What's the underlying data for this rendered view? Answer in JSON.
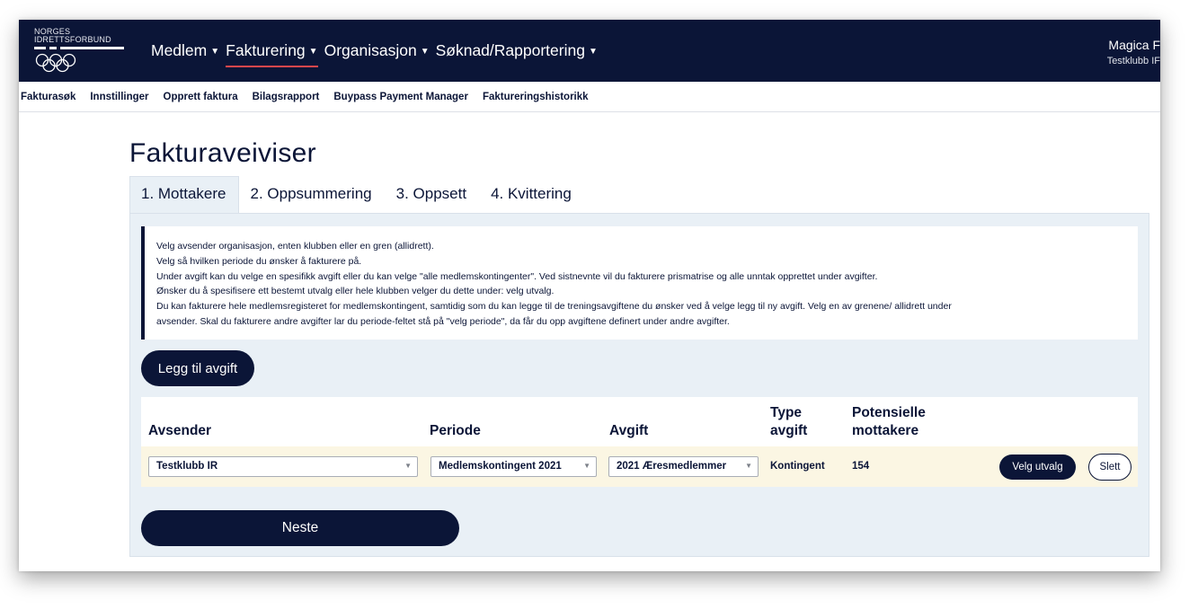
{
  "header": {
    "logo": {
      "line1": "NORGES",
      "line2": "IDRETTSFORBUND"
    },
    "nav": [
      {
        "label": "Medlem",
        "active": false
      },
      {
        "label": "Fakturering",
        "active": true
      },
      {
        "label": "Organisasjon",
        "active": false
      },
      {
        "label": "Søknad/Rapportering",
        "active": false
      }
    ],
    "user": {
      "name": "Magica F",
      "club": "Testklubb IF"
    }
  },
  "subnav": [
    "Fakturasøk",
    "Innstillinger",
    "Opprett faktura",
    "Bilagsrapport",
    "Buypass Payment Manager",
    "Faktureringshistorikk"
  ],
  "page": {
    "title": "Fakturaveiviser",
    "tabs": [
      {
        "label": "1. Mottakere",
        "active": true
      },
      {
        "label": "2. Oppsummering",
        "active": false
      },
      {
        "label": "3. Oppsett",
        "active": false
      },
      {
        "label": "4. Kvittering",
        "active": false
      }
    ],
    "info_lines": [
      "Velg avsender organisasjon, enten klubben eller en gren (allidrett).",
      "Velg så hvilken periode du ønsker å fakturere på.",
      "Under avgift kan du velge en spesifikk avgift eller du kan velge \"alle medlemskontingenter\". Ved sistnevnte vil du fakturere prismatrise og alle unntak opprettet under avgifter.",
      "Ønsker du å spesifisere ett bestemt utvalg eller hele klubben velger du dette under: velg utvalg.",
      "Du kan fakturere hele medlemsregisteret for medlemskontingent, samtidig som du kan legge til de treningsavgiftene du ønsker ved å velge legg til ny avgift. Velg en av grenene/ allidrett under",
      "avsender. Skal du fakturere andre avgifter lar du periode-feltet stå på \"velg periode\", da får du opp avgiftene definert under andre avgifter."
    ],
    "add_fee_label": "Legg til avgift",
    "table": {
      "headers": {
        "avsender": "Avsender",
        "periode": "Periode",
        "avgift": "Avgift",
        "type_line1": "Type",
        "type_line2": "avgift",
        "pot_line1": "Potensielle",
        "pot_line2": "mottakere"
      },
      "row": {
        "avsender": "Testklubb IR",
        "periode": "Medlemskontingent 2021",
        "avgift": "2021 Æresmedlemmer",
        "type": "Kontingent",
        "mottakere": "154",
        "velg_label": "Velg utvalg",
        "slett_label": "Slett"
      }
    },
    "next_label": "Neste"
  }
}
